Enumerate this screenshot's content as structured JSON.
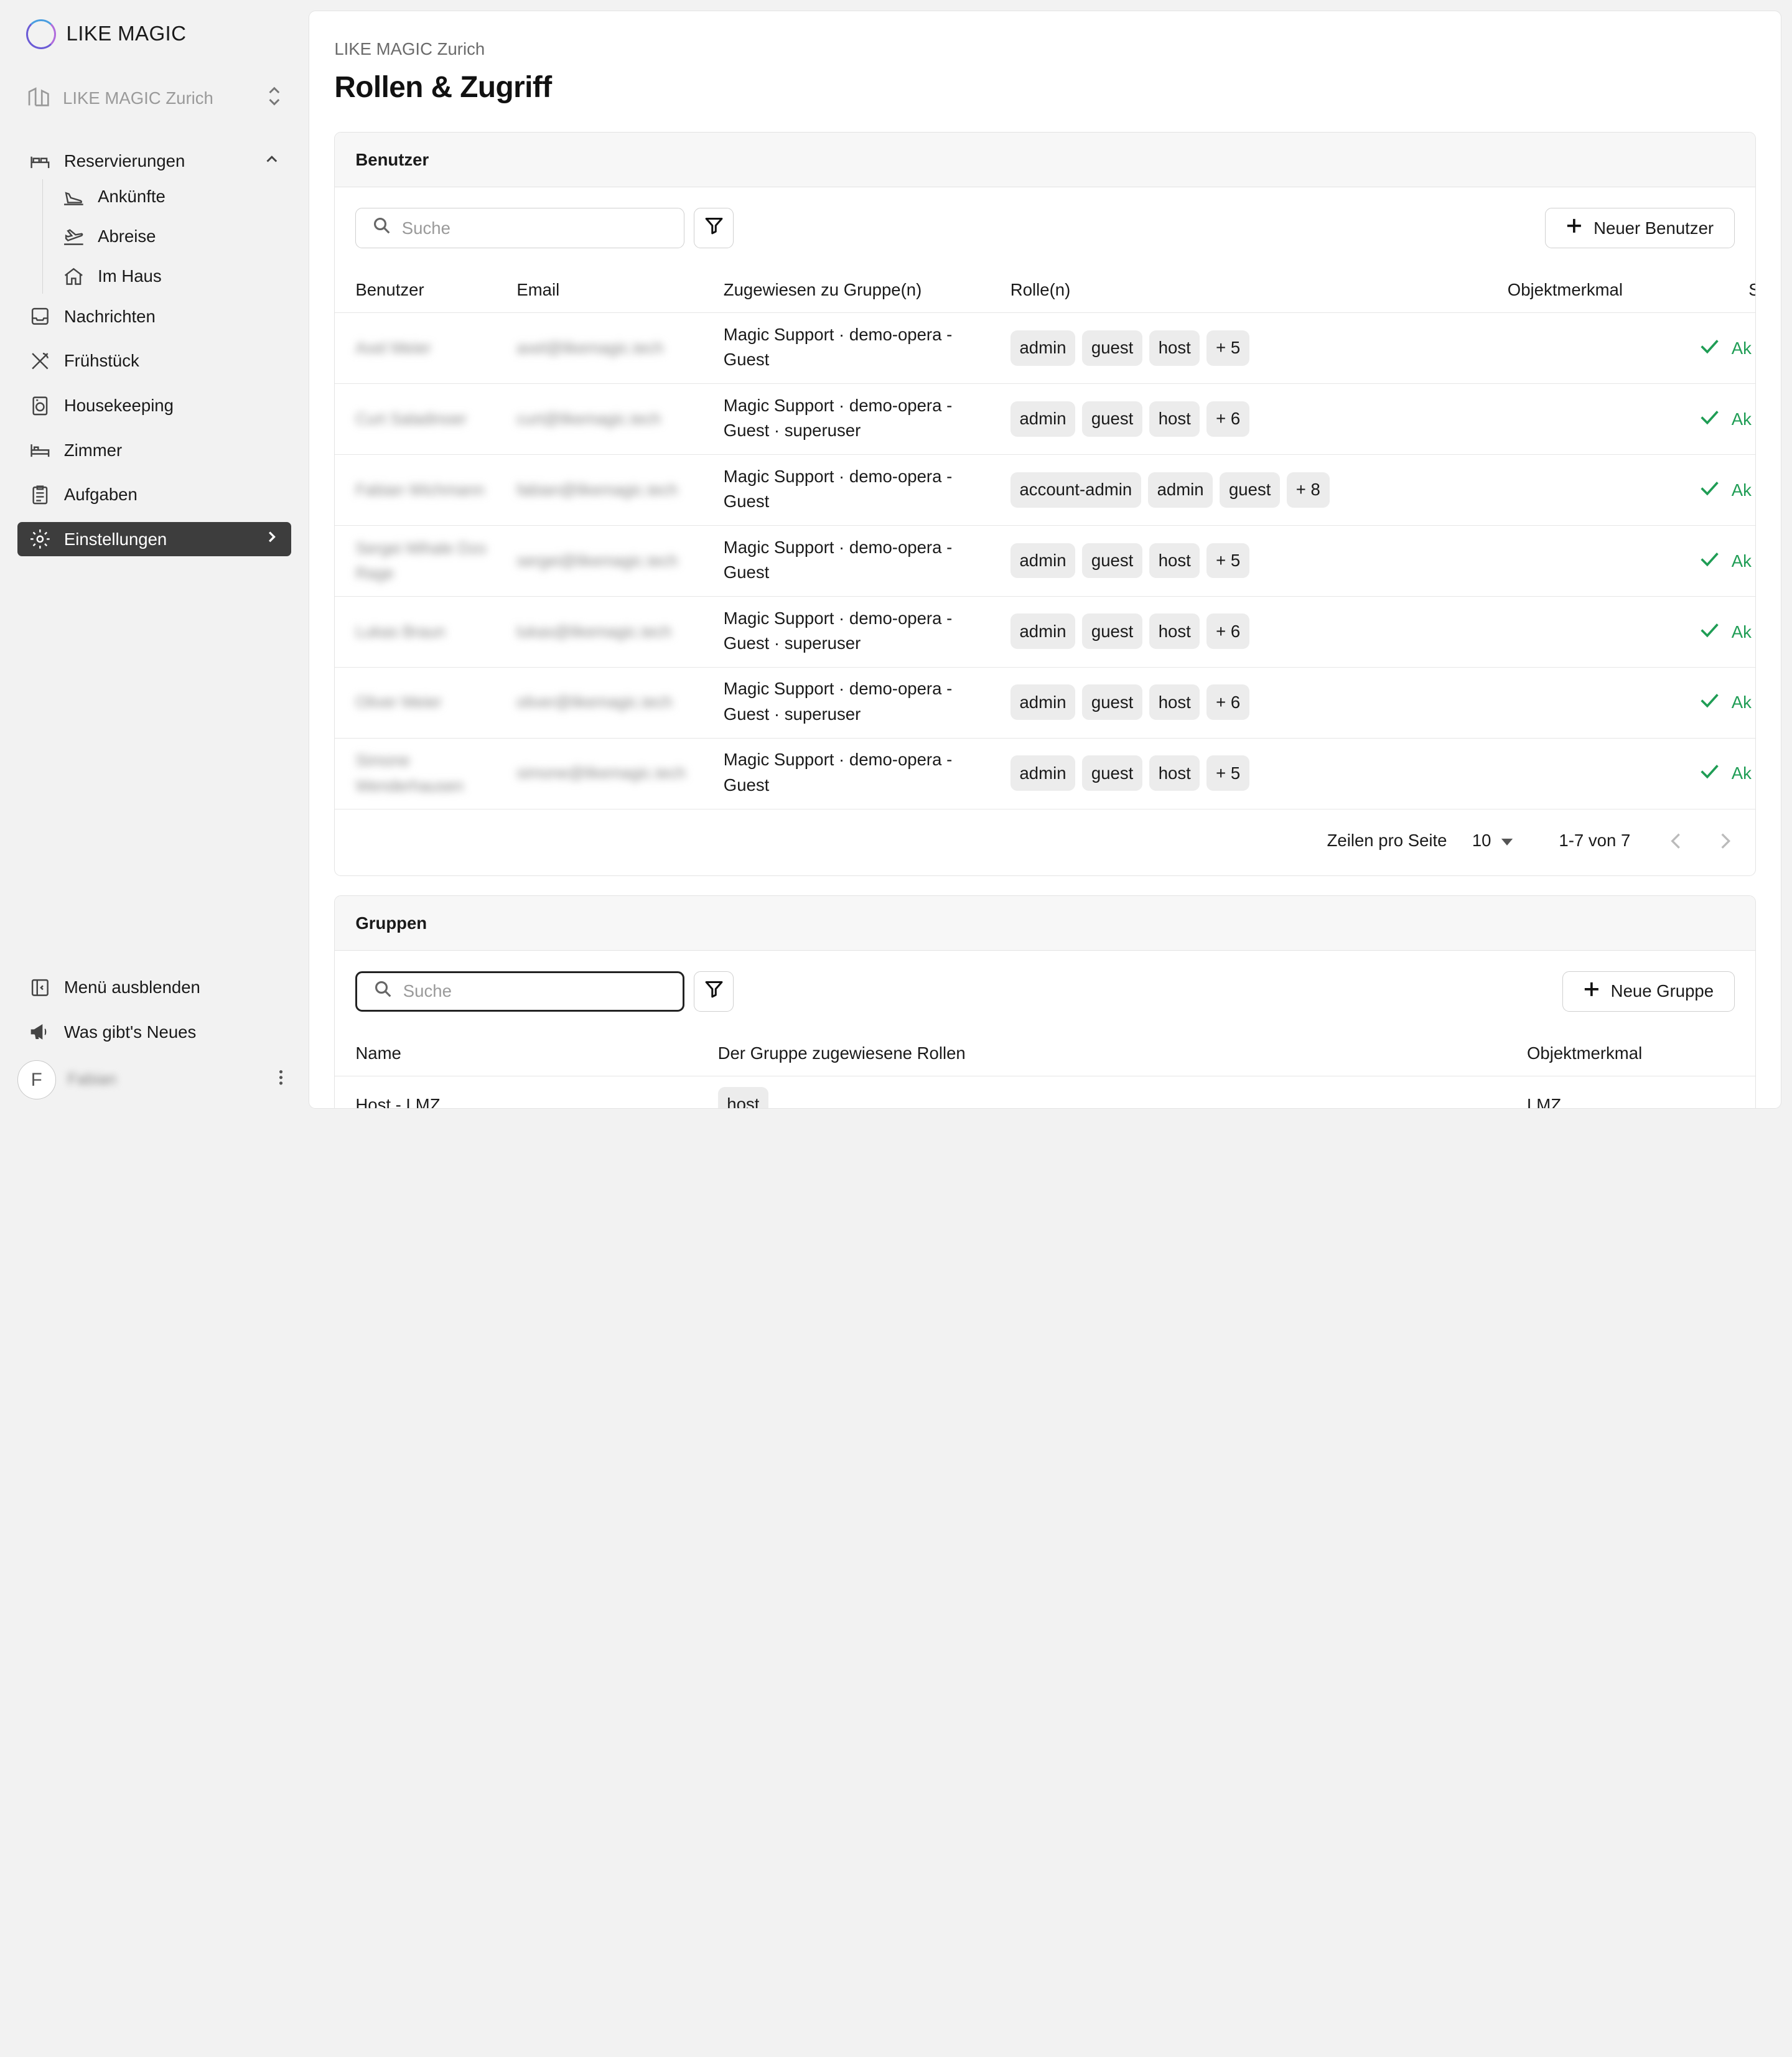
{
  "brand": {
    "name": "LIKE MAGIC"
  },
  "property": {
    "name": "LIKE MAGIC Zurich"
  },
  "nav": {
    "reservations": "Reservierungen",
    "arrivals": "Ankünfte",
    "departures": "Abreise",
    "in_house": "Im Haus",
    "messages": "Nachrichten",
    "breakfast": "Frühstück",
    "housekeeping": "Housekeeping",
    "rooms": "Zimmer",
    "tasks": "Aufgaben",
    "settings": "Einstellungen"
  },
  "bottom": {
    "hide_menu": "Menü ausblenden",
    "whats_new": "Was gibt's Neues"
  },
  "user": {
    "initial": "F",
    "name": "Fabian"
  },
  "page": {
    "breadcrumb": "LIKE MAGIC Zurich",
    "title": "Rollen & Zugriff"
  },
  "users_card": {
    "title": "Benutzer",
    "search_placeholder": "Suche",
    "add_label": "Neuer Benutzer",
    "columns": {
      "user": "Benutzer",
      "email": "Email",
      "groups": "Zugewiesen zu Gruppe(n)",
      "roles": "Rolle(n)",
      "attribute": "Objektmerkmal",
      "status": "S"
    },
    "rows": [
      {
        "name": "Axel Meier",
        "email": "axel@likemagic.tech",
        "groups": "Magic Support · demo-opera - Guest",
        "roles": [
          "admin",
          "guest",
          "host",
          "+ 5"
        ],
        "status": "Ak"
      },
      {
        "name": "Curt Saladinoer",
        "email": "curt@likemagic.tech",
        "groups": "Magic Support · demo-opera - Guest · superuser",
        "roles": [
          "admin",
          "guest",
          "host",
          "+ 6"
        ],
        "status": "Ak"
      },
      {
        "name": "Fabian Wichmann",
        "email": "fabian@likemagic.tech",
        "groups": "Magic Support · demo-opera - Guest",
        "roles": [
          "account-admin",
          "admin",
          "guest",
          "+ 8"
        ],
        "status": "Ak"
      },
      {
        "name": "Sergei Mihale Dzo Rage",
        "email": "sergei@likemagic.tech",
        "groups": "Magic Support · demo-opera - Guest",
        "roles": [
          "admin",
          "guest",
          "host",
          "+ 5"
        ],
        "status": "Ak"
      },
      {
        "name": "Lukas Braun",
        "email": "lukas@likemagic.tech",
        "groups": "Magic Support · demo-opera - Guest · superuser",
        "roles": [
          "admin",
          "guest",
          "host",
          "+ 6"
        ],
        "status": "Ak"
      },
      {
        "name": "Oliver Meier",
        "email": "oliver@likemagic.tech",
        "groups": "Magic Support · demo-opera - Guest · superuser",
        "roles": [
          "admin",
          "guest",
          "host",
          "+ 6"
        ],
        "status": "Ak"
      },
      {
        "name": "Simone Wenderhausen",
        "email": "simone@likemagic.tech",
        "groups": "Magic Support · demo-opera - Guest",
        "roles": [
          "admin",
          "guest",
          "host",
          "+ 5"
        ],
        "status": "Ak"
      }
    ],
    "pagination": {
      "rows_per_page_label": "Zeilen pro Seite",
      "rows_per_page": "10",
      "range": "1-7 von 7"
    }
  },
  "groups_card": {
    "title": "Gruppen",
    "search_placeholder": "Suche",
    "add_label": "Neue Gruppe",
    "columns": {
      "name": "Name",
      "roles": "Der Gruppe zugewiesene Rollen",
      "attribute": "Objektmerkmal"
    },
    "rows": [
      {
        "name": "Host - LMZ",
        "roles": [
          "host"
        ],
        "attribute": "LMZ"
      }
    ]
  },
  "colors": {
    "active_nav": "#3d3d3d",
    "status_green": "#1f9d55",
    "chip_bg": "#ececec"
  }
}
